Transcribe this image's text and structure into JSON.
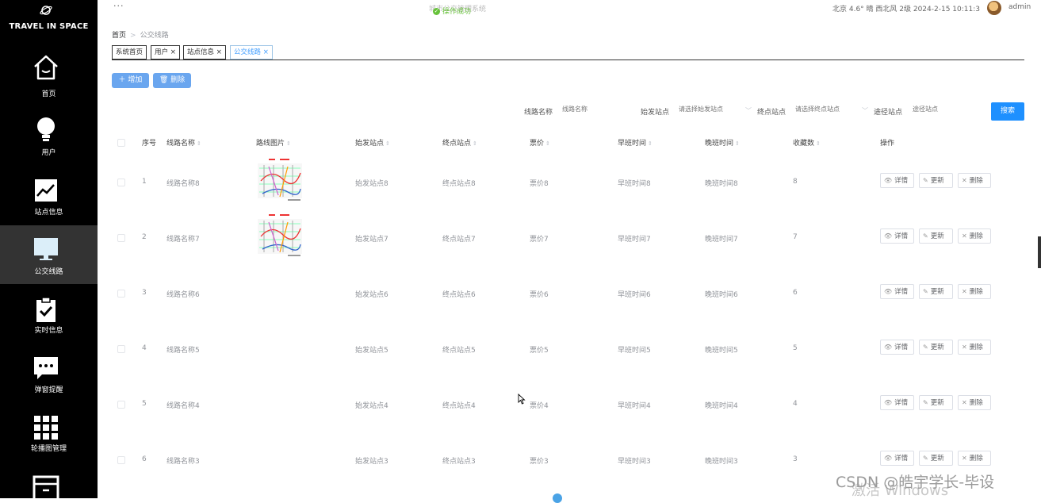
{
  "brand": {
    "name": "TRAVEL IN SPACE"
  },
  "sidebar": {
    "items": [
      {
        "label": "首页",
        "icon": "home-icon"
      },
      {
        "label": "用户",
        "icon": "lightbulb-icon"
      },
      {
        "label": "站点信息",
        "icon": "chart-icon"
      },
      {
        "label": "公交线路",
        "icon": "monitor-icon",
        "active": true
      },
      {
        "label": "实时信息",
        "icon": "clipboard-check-icon"
      },
      {
        "label": "弹窗提醒",
        "icon": "chat-icon"
      },
      {
        "label": "轮播图管理",
        "icon": "grid-icon"
      },
      {
        "label": "",
        "icon": "archive-icon"
      }
    ]
  },
  "topbar": {
    "app_title": "城市公交管理系统",
    "toast": "操作成功",
    "weather": "北京  4.6°  晴  西北风  2级  2024-2-15 10:11:3",
    "username": "admin"
  },
  "breadcrumb": {
    "home": "首页",
    "current": "公交线路"
  },
  "tags": [
    "系统首页",
    "用户",
    "站点信息",
    "公交线路"
  ],
  "toolbar": {
    "add": "增加",
    "delete": "删除"
  },
  "search": {
    "route_name_label": "线路名称",
    "route_name_placeholder": "线路名称",
    "start_label": "始发站点",
    "start_placeholder": "请选择始发站点",
    "end_label": "终点站点",
    "end_placeholder": "请选择终点站点",
    "via_label": "途径站点",
    "via_placeholder": "途径站点",
    "search_button": "搜索"
  },
  "table": {
    "headers": [
      "序号",
      "线路名称",
      "路线图片",
      "始发站点",
      "终点站点",
      "票价",
      "早班时间",
      "晚班时间",
      "收藏数",
      "操作"
    ],
    "actions": {
      "detail": "详情",
      "update": "更新",
      "delete": "删除"
    },
    "rows": [
      {
        "no": "1",
        "name": "线路名称8",
        "start": "始发站点8",
        "end": "终点站点8",
        "price": "票价8",
        "early": "早班时间8",
        "late": "晚班时间8",
        "fav": "8",
        "has_image": true
      },
      {
        "no": "2",
        "name": "线路名称7",
        "start": "始发站点7",
        "end": "终点站点7",
        "price": "票价7",
        "early": "早班时间7",
        "late": "晚班时间7",
        "fav": "7",
        "has_image": true
      },
      {
        "no": "3",
        "name": "线路名称6",
        "start": "始发站点6",
        "end": "终点站点6",
        "price": "票价6",
        "early": "早班时间6",
        "late": "晚班时间6",
        "fav": "6",
        "has_image": false
      },
      {
        "no": "4",
        "name": "线路名称5",
        "start": "始发站点5",
        "end": "终点站点5",
        "price": "票价5",
        "early": "早班时间5",
        "late": "晚班时间5",
        "fav": "5",
        "has_image": false
      },
      {
        "no": "5",
        "name": "线路名称4",
        "start": "始发站点4",
        "end": "终点站点4",
        "price": "票价4",
        "early": "早班时间4",
        "late": "晚班时间4",
        "fav": "4",
        "has_image": false
      },
      {
        "no": "6",
        "name": "线路名称3",
        "start": "始发站点3",
        "end": "终点站点3",
        "price": "票价3",
        "early": "早班时间3",
        "late": "晚班时间3",
        "fav": "3",
        "has_image": false
      }
    ]
  },
  "watermark": {
    "csdn": "CSDN @皓宇学长-毕设",
    "windows": "激活 Windows"
  },
  "colors": {
    "sidebar_bg": "#000000",
    "sidebar_active": "#333333",
    "primary": "#409eff",
    "success": "#67c23a"
  }
}
